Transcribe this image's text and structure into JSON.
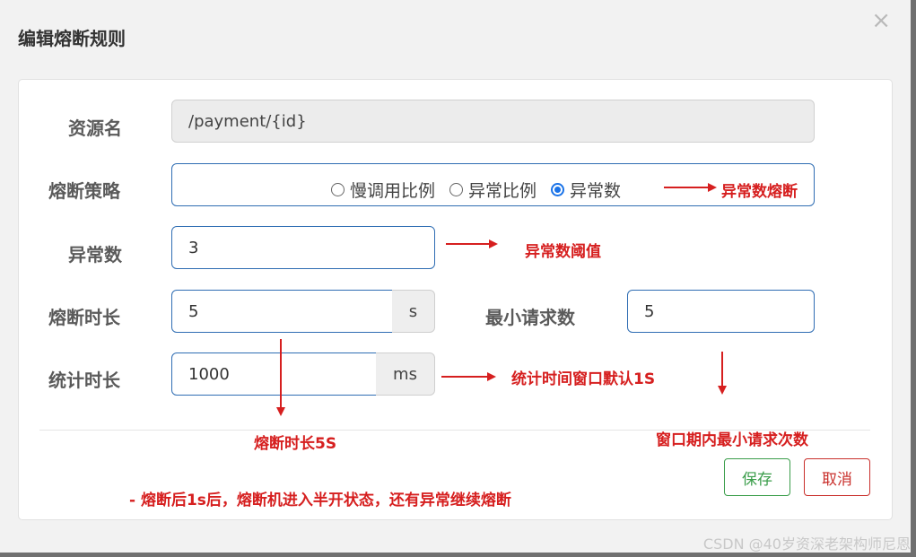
{
  "dialog": {
    "title": "编辑熔断规则"
  },
  "form": {
    "resource": {
      "label": "资源名",
      "value": "/payment/{id}"
    },
    "strategy": {
      "label": "熔断策略",
      "options": [
        "慢调用比例",
        "异常比例",
        "异常数"
      ],
      "selected": "异常数"
    },
    "exception_count": {
      "label": "异常数",
      "value": "3"
    },
    "break_duration": {
      "label": "熔断时长",
      "value": "5",
      "unit": "s"
    },
    "min_requests": {
      "label": "最小请求数",
      "value": "5"
    },
    "stat_duration": {
      "label": "统计时长",
      "value": "1000",
      "unit": "ms"
    }
  },
  "buttons": {
    "save": "保存",
    "cancel": "取消"
  },
  "annotations": {
    "strategy": "异常数熔断",
    "threshold": "异常数阈值",
    "stat_window": "统计时间窗口默认1S",
    "break_duration": "熔断时长5S",
    "min_requests": "窗口期内最小请求次数",
    "note": "- 熔断后1s后，熔断机进入半开状态，还有异常继续熔断"
  },
  "watermark": "CSDN @40岁资深老架构师尼恩",
  "colors": {
    "annotation": "#d61f1f",
    "save": "#3a9d4a",
    "cancel": "#c9302c",
    "radio_selected": "#1a73e8"
  },
  "icons": {
    "close": "close-icon"
  }
}
